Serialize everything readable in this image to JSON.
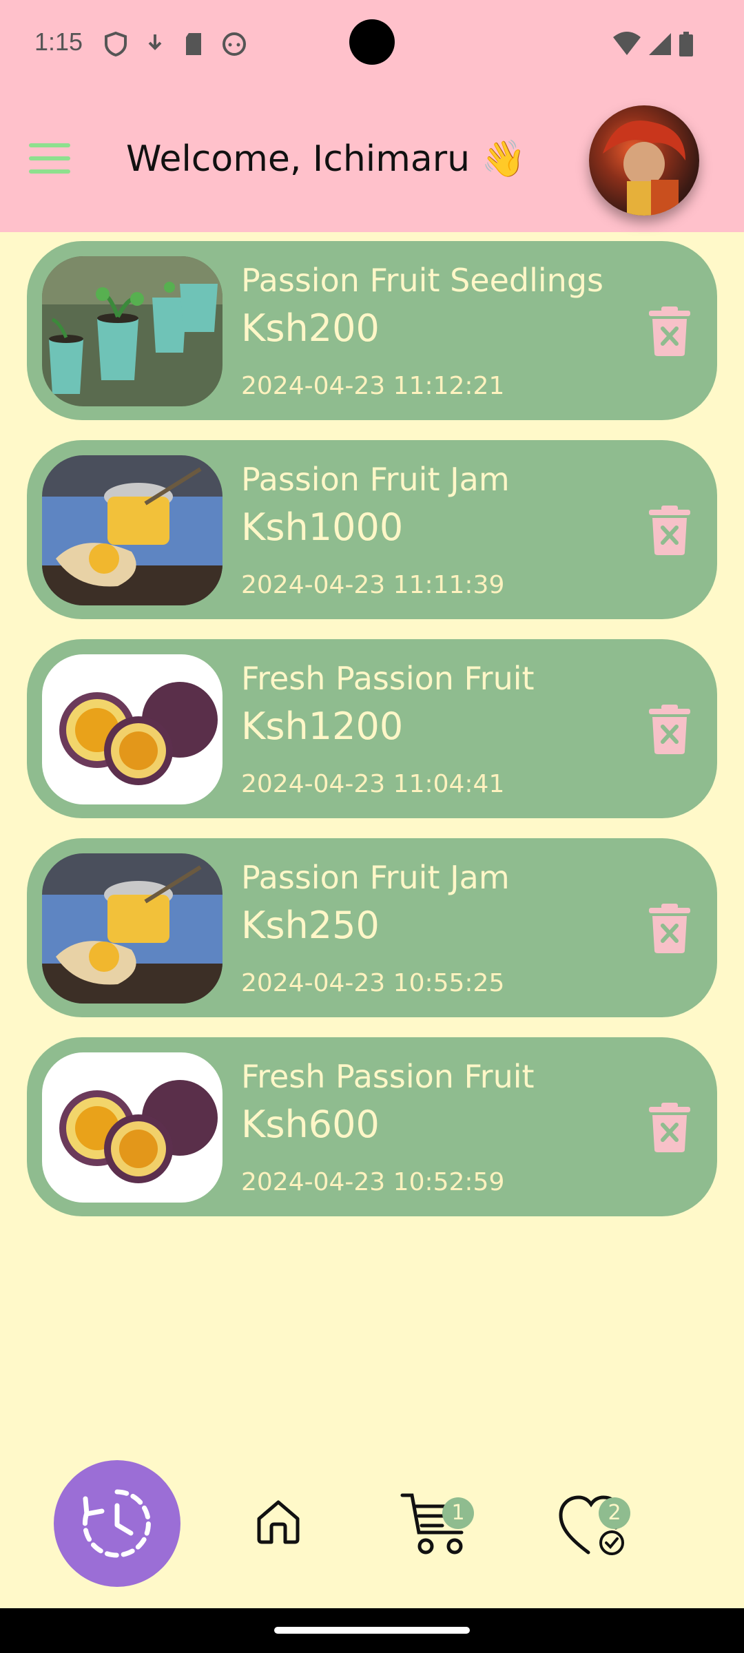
{
  "status_bar": {
    "time": "1:15",
    "icons": [
      "vpn-icon",
      "download-icon",
      "sd-card-icon",
      "face-icon",
      "wifi-icon",
      "signal-icon",
      "battery-icon"
    ]
  },
  "header": {
    "welcome_text": "Welcome, Ichimaru 👋",
    "menu_icon": "hamburger-menu-icon",
    "avatar_icon": "profile-avatar"
  },
  "orders": [
    {
      "title": "Passion Fruit Seedlings",
      "price": "Ksh200",
      "date": "2024-04-23 11:12:21",
      "image": "seedlings"
    },
    {
      "title": "Passion Fruit Jam",
      "price": "Ksh1000",
      "date": "2024-04-23 11:11:39",
      "image": "jam"
    },
    {
      "title": "Fresh Passion Fruit",
      "price": "Ksh1200",
      "date": "2024-04-23 11:04:41",
      "image": "fruit"
    },
    {
      "title": "Passion Fruit Jam",
      "price": "Ksh250",
      "date": "2024-04-23 10:55:25",
      "image": "jam"
    },
    {
      "title": "Fresh Passion Fruit",
      "price": "Ksh600",
      "date": "2024-04-23 10:52:59",
      "image": "fruit"
    }
  ],
  "bottom_nav": {
    "history_icon": "history-icon",
    "home_icon": "home-icon",
    "cart_icon": "cart-icon",
    "cart_badge": "1",
    "wishlist_icon": "heart-check-icon",
    "wishlist_badge": "2"
  },
  "colors": {
    "header_bg": "#FFC1CB",
    "page_bg": "#FFF9C9",
    "card_bg": "#8FBC8F",
    "text_cream": "#FFF7C8",
    "trash_pink": "#F7C1C8",
    "fab_purple": "#9B6ED6"
  }
}
